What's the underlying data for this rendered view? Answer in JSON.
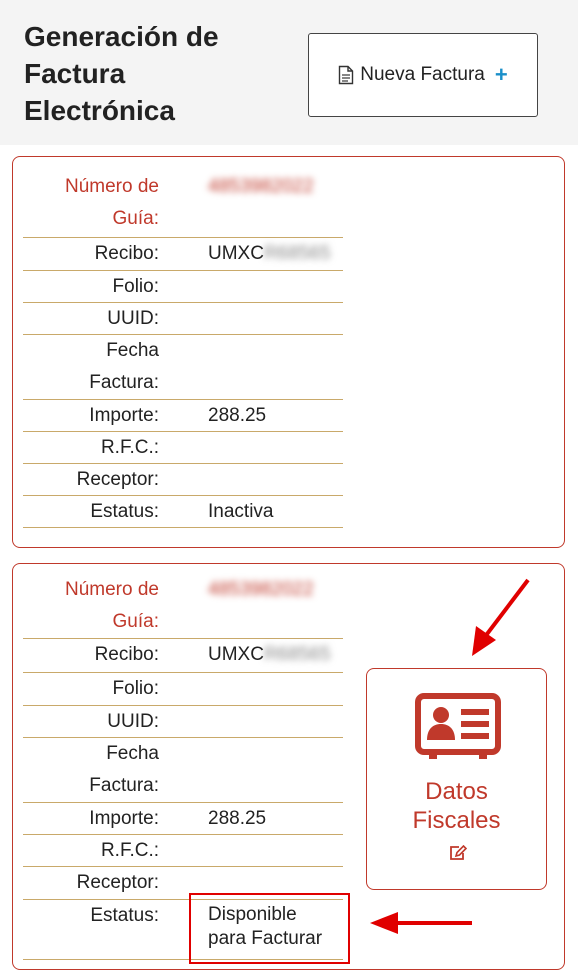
{
  "header": {
    "title": "Generación de Factura Electrónica",
    "new_invoice_label": "Nueva Factura",
    "plus": "+"
  },
  "labels": {
    "guia_line1": "Número de",
    "guia_line2": "Guía:",
    "recibo": "Recibo:",
    "folio": "Folio:",
    "uuid": "UUID:",
    "fecha_line1": "Fecha",
    "fecha_line2": "Factura:",
    "importe": "Importe:",
    "rfc": "R.F.C.:",
    "receptor": "Receptor:",
    "estatus": "Estatus:"
  },
  "invoices": [
    {
      "numero_guia": "4853982022",
      "recibo_prefix": "UMXC",
      "recibo_redacted": "R68565",
      "folio": "",
      "uuid": "",
      "fecha_factura": "",
      "importe": "288.25",
      "rfc": "",
      "receptor": "",
      "estatus": "Inactiva"
    },
    {
      "numero_guia": "4853982022",
      "recibo_prefix": "UMXC",
      "recibo_redacted": "R68565",
      "folio": "",
      "uuid": "",
      "fecha_factura": "",
      "importe": "288.25",
      "rfc": "",
      "receptor": "",
      "estatus_line1": "Disponible",
      "estatus_line2": "para Facturar"
    }
  ],
  "fiscal": {
    "label_line1": "Datos",
    "label_line2": "Fiscales"
  },
  "icons": {
    "doc": "document-icon",
    "id_card": "id-card-icon",
    "edit": "edit-icon"
  },
  "colors": {
    "accent": "#c0392b",
    "plus": "#1a8fc9",
    "annotation": "#e00000",
    "row_divider": "#c9a96a"
  }
}
